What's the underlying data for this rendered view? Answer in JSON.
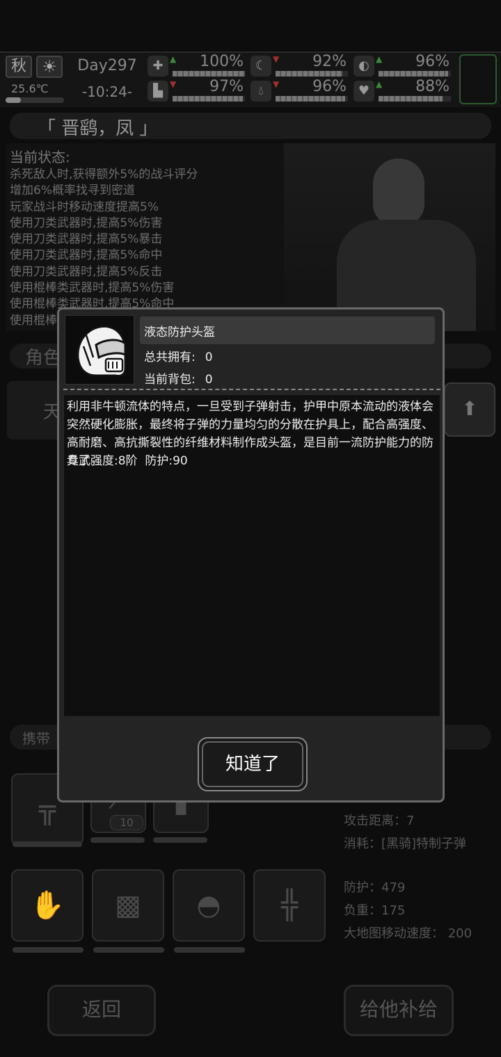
{
  "topbar": {
    "season": "秋",
    "temperature": "25.6℃",
    "day": "Day297",
    "time": "-10:24-",
    "stats": [
      {
        "icon": "medkit-icon",
        "arrow": "up",
        "percent": "100%",
        "value": 1.0
      },
      {
        "icon": "stomach-icon",
        "arrow": "down",
        "percent": "92%",
        "value": 0.92
      },
      {
        "icon": "pill-icon",
        "arrow": "up",
        "percent": "96%",
        "value": 0.96
      },
      {
        "icon": "foot-icon",
        "arrow": "down",
        "percent": "97%",
        "value": 0.97
      },
      {
        "icon": "water-drop-icon",
        "arrow": "down",
        "percent": "96%",
        "value": 0.96
      },
      {
        "icon": "heart-icon",
        "arrow": "up",
        "percent": "88%",
        "value": 0.88
      }
    ]
  },
  "character": {
    "name": "「 晋鹞，凤 」",
    "status_title": "当前状态:",
    "status_lines": [
      "杀死敌人时,获得额外5%的战斗评分",
      "增加6%概率找寻到密道",
      "玩家战斗时移动速度提高5%",
      "使用刀类武器时,提高5%伤害",
      "使用刀类武器时,提高5%暴击",
      "使用刀类武器时,提高5%命中",
      "使用刀类武器时,提高5%反击",
      "使用棍棒类武器时,提高5%伤害",
      "使用棍棒类武器时,提高5%命中",
      "使用棍棒"
    ]
  },
  "sections": {
    "role_label": "角色",
    "role_left": "天",
    "carry_label": "携带"
  },
  "weapon": {
    "ammo_count": "10",
    "range": "攻击距离：7",
    "consumes": "消耗：[黑骑]特制子弹"
  },
  "armor": {
    "defense": "防护：479",
    "weight": "负重：175",
    "map_speed": "大地图移动速度：  200"
  },
  "bottom": {
    "back": "返回",
    "supply": "给他补给"
  },
  "modal": {
    "item_name": "液态防护头盔",
    "owned_label": "总共拥有:",
    "owned_value": "0",
    "bag_label": "当前背包:",
    "bag_value": "0",
    "description": "利用非牛顿流体的特点，一旦受到子弹射击，护甲中原本流动的液体会突然硬化膨胀，最终将子弹的力量均匀的分散在护具上，配合高强度、高耐磨、高抗撕裂性的纤维材料制作成头盔，是目前一流防护能力的防具了。",
    "stats": "专武强度:8阶  防护:90",
    "ok": "知道了"
  }
}
